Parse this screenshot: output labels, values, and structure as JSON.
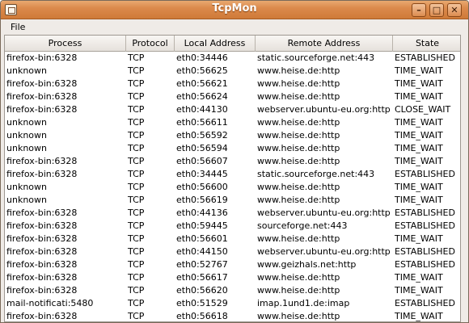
{
  "window": {
    "title": "TcpMon"
  },
  "menu": {
    "file_label": "File"
  },
  "table": {
    "columns": [
      "Process",
      "Protocol",
      "Local Address",
      "Remote Address",
      "State"
    ],
    "rows": [
      [
        "firefox-bin:6328",
        "TCP",
        "eth0:34446",
        "static.sourceforge.net:443",
        "ESTABLISHED"
      ],
      [
        "unknown",
        "TCP",
        "eth0:56625",
        "www.heise.de:http",
        "TIME_WAIT"
      ],
      [
        "firefox-bin:6328",
        "TCP",
        "eth0:56621",
        "www.heise.de:http",
        "TIME_WAIT"
      ],
      [
        "firefox-bin:6328",
        "TCP",
        "eth0:56624",
        "www.heise.de:http",
        "TIME_WAIT"
      ],
      [
        "firefox-bin:6328",
        "TCP",
        "eth0:44130",
        "webserver.ubuntu-eu.org:http",
        "CLOSE_WAIT"
      ],
      [
        "unknown",
        "TCP",
        "eth0:56611",
        "www.heise.de:http",
        "TIME_WAIT"
      ],
      [
        "unknown",
        "TCP",
        "eth0:56592",
        "www.heise.de:http",
        "TIME_WAIT"
      ],
      [
        "unknown",
        "TCP",
        "eth0:56594",
        "www.heise.de:http",
        "TIME_WAIT"
      ],
      [
        "firefox-bin:6328",
        "TCP",
        "eth0:56607",
        "www.heise.de:http",
        "TIME_WAIT"
      ],
      [
        "firefox-bin:6328",
        "TCP",
        "eth0:34445",
        "static.sourceforge.net:443",
        "ESTABLISHED"
      ],
      [
        "unknown",
        "TCP",
        "eth0:56600",
        "www.heise.de:http",
        "TIME_WAIT"
      ],
      [
        "unknown",
        "TCP",
        "eth0:56619",
        "www.heise.de:http",
        "TIME_WAIT"
      ],
      [
        "firefox-bin:6328",
        "TCP",
        "eth0:44136",
        "webserver.ubuntu-eu.org:http",
        "ESTABLISHED"
      ],
      [
        "firefox-bin:6328",
        "TCP",
        "eth0:59445",
        "sourceforge.net:443",
        "ESTABLISHED"
      ],
      [
        "firefox-bin:6328",
        "TCP",
        "eth0:56601",
        "www.heise.de:http",
        "TIME_WAIT"
      ],
      [
        "firefox-bin:6328",
        "TCP",
        "eth0:44150",
        "webserver.ubuntu-eu.org:http",
        "ESTABLISHED"
      ],
      [
        "firefox-bin:6328",
        "TCP",
        "eth0:52767",
        "www.geizhals.net:http",
        "ESTABLISHED"
      ],
      [
        "firefox-bin:6328",
        "TCP",
        "eth0:56617",
        "www.heise.de:http",
        "TIME_WAIT"
      ],
      [
        "firefox-bin:6328",
        "TCP",
        "eth0:56620",
        "www.heise.de:http",
        "TIME_WAIT"
      ],
      [
        "mail-notificati:5480",
        "TCP",
        "eth0:51529",
        "imap.1und1.de:imap",
        "ESTABLISHED"
      ],
      [
        "firefox-bin:6328",
        "TCP",
        "eth0:56618",
        "www.heise.de:http",
        "TIME_WAIT"
      ]
    ]
  }
}
